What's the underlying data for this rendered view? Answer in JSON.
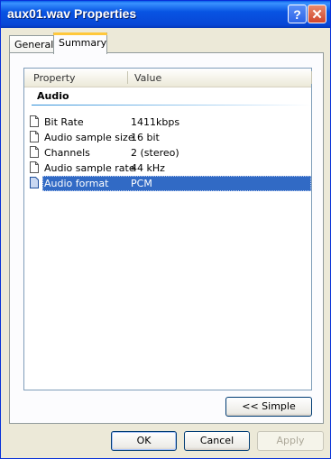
{
  "window": {
    "title": "aux01.wav Properties",
    "help_label": "?",
    "close_label": "✕"
  },
  "tabs": [
    {
      "label": "General"
    },
    {
      "label": "Summary"
    }
  ],
  "list": {
    "columns": [
      "Property",
      "Value"
    ],
    "group": "Audio",
    "rows": [
      {
        "property": "Bit Rate",
        "value": "1411kbps"
      },
      {
        "property": "Audio sample size",
        "value": "16 bit"
      },
      {
        "property": "Channels",
        "value": "2 (stereo)"
      },
      {
        "property": "Audio sample rate",
        "value": "44 kHz"
      },
      {
        "property": "Audio format",
        "value": "PCM"
      }
    ],
    "selected_row": "Audio format"
  },
  "buttons": {
    "simple": "<< Simple",
    "ok": "OK",
    "cancel": "Cancel",
    "apply": "Apply"
  },
  "colors": {
    "titlebar": "#0854e3",
    "selection": "#316ac5",
    "face": "#ece9d8",
    "tab_accent": "#ffc83c"
  }
}
